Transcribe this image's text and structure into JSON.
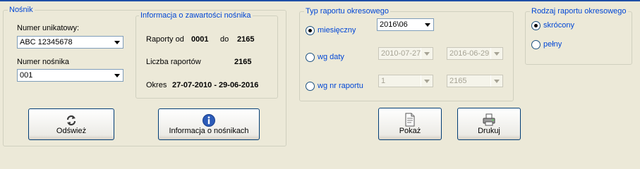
{
  "nosnik": {
    "legend": "Nośnik",
    "numer_unikatowy_label": "Numer unikatowy:",
    "numer_unikatowy_value": "ABC 12345678",
    "numer_nosnika_label": "Numer nośnika",
    "numer_nosnika_value": "001",
    "info": {
      "legend": "Informacja o zawartości nośnika",
      "raporty_od_label": "Raporty od",
      "raporty_od_value": "0001",
      "do_label": "do",
      "do_value": "2165",
      "liczba_label": "Liczba raportów",
      "liczba_value": "2165",
      "okres_label": "Okres",
      "okres_value": "27-07-2010 - 29-06-2016"
    },
    "odswiez_label": "Odśwież",
    "info_button_label": "Informacja o nośnikach"
  },
  "typ_raportu": {
    "legend": "Typ raportu okresowego",
    "miesieczny_label": "miesięczny",
    "miesieczny_value": "2016\\06",
    "wg_daty_label": "wg daty",
    "data_od": "2010-07-27",
    "data_do": "2016-06-29",
    "wg_nr_label": "wg nr raportu",
    "nr_od": "1",
    "nr_do": "2165",
    "selected": "miesieczny"
  },
  "rodzaj_raportu": {
    "legend": "Rodzaj raportu okresowego",
    "skrocony_label": "skrócony",
    "pelny_label": "pełny",
    "selected": "skrocony"
  },
  "actions": {
    "pokaz_label": "Pokaż",
    "drukuj_label": "Drukuj"
  },
  "colors": {
    "accent": "#0046d5",
    "background": "#ece9d8"
  },
  "icons": {
    "refresh": "refresh-icon",
    "info": "info-icon",
    "preview": "document-preview-icon",
    "print": "printer-icon"
  }
}
